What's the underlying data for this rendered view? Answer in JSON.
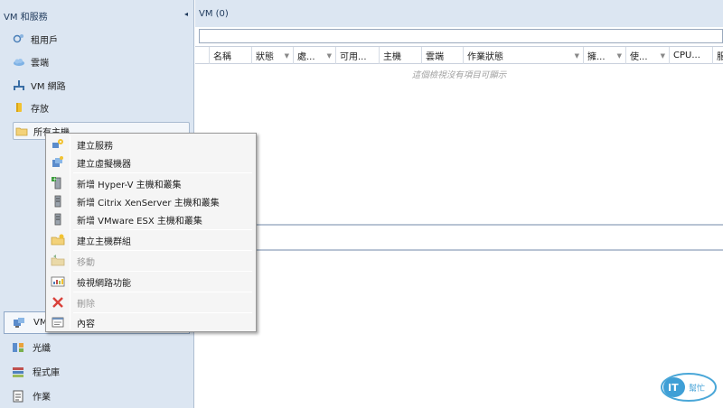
{
  "nav": {
    "header": "VM 和服務",
    "tree": [
      {
        "label": "租用戶",
        "icon": "tenant-icon"
      },
      {
        "label": "雲端",
        "icon": "cloud-icon"
      },
      {
        "label": "VM 網路",
        "icon": "network-icon"
      },
      {
        "label": "存放",
        "icon": "storage-icon"
      },
      {
        "label": "所有主機",
        "icon": "folder-icon"
      }
    ],
    "workspaces": [
      {
        "label": "VM",
        "icon": "vm-services-icon"
      },
      {
        "label": "光纖",
        "icon": "fabric-icon"
      },
      {
        "label": "程式庫",
        "icon": "library-icon"
      },
      {
        "label": "作業",
        "icon": "jobs-icon"
      }
    ]
  },
  "main": {
    "title": "VM (0)",
    "columns": [
      "",
      "名稱",
      "狀態",
      "處...",
      "可用...",
      "主機",
      "雲端",
      "作業狀態",
      "擁...",
      "使...",
      "CPU...",
      "服"
    ],
    "empty_message": "這個檢視沒有項目可顯示"
  },
  "context_menu": {
    "items": [
      {
        "label": "建立服務",
        "icon": "create-service-icon",
        "disabled": false
      },
      {
        "label": "建立虛擬機器",
        "icon": "create-vm-icon",
        "disabled": false
      },
      {
        "label": "新增 Hyper-V 主機和叢集",
        "icon": "add-hyperv-host-icon",
        "disabled": false
      },
      {
        "label": "新增 Citrix XenServer 主機和叢集",
        "icon": "add-xenserver-host-icon",
        "disabled": false
      },
      {
        "label": "新增 VMware ESX 主機和叢集",
        "icon": "add-esx-host-icon",
        "disabled": false
      },
      {
        "label": "建立主機群組",
        "icon": "create-host-group-icon",
        "disabled": false
      },
      {
        "label": "移動",
        "icon": "move-icon",
        "disabled": true
      },
      {
        "label": "檢視網路功能",
        "icon": "view-networking-icon",
        "disabled": false
      },
      {
        "label": "刪除",
        "icon": "delete-icon",
        "disabled": true
      },
      {
        "label": "內容",
        "icon": "properties-icon",
        "disabled": false
      }
    ]
  },
  "watermark": {
    "text": "IT",
    "sub": "幫忙"
  },
  "colors": {
    "nav_bg": "#dce6f2",
    "accent": "#1e395b",
    "menu_bg": "#f5f5f5"
  }
}
